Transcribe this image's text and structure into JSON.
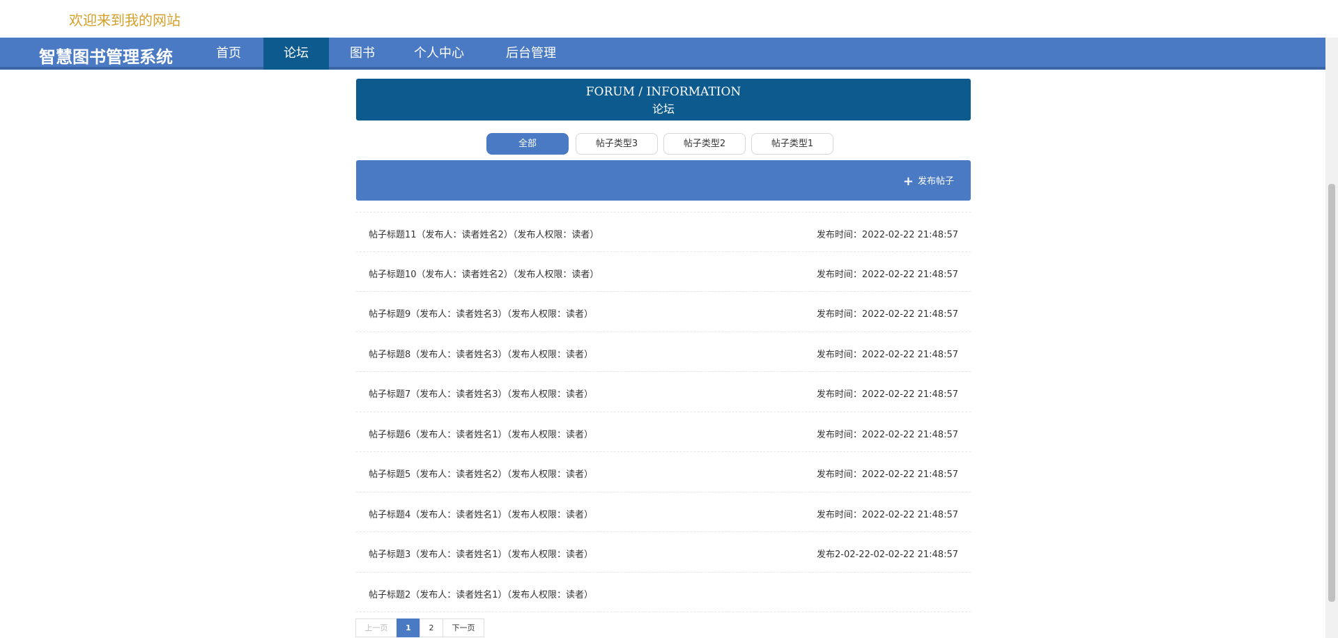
{
  "header": {
    "welcome": "欢迎来到我的网站"
  },
  "nav": {
    "brand": "智慧图书管理系统",
    "items": [
      {
        "label": "首页"
      },
      {
        "label": "论坛"
      },
      {
        "label": "图书"
      },
      {
        "label": "个人中心"
      },
      {
        "label": "后台管理"
      }
    ],
    "active": "论坛"
  },
  "forum": {
    "title_en": "FORUM / INFORMATION",
    "title_cn": "论坛"
  },
  "filters": [
    {
      "label": "全部"
    },
    {
      "label": "帖子类型3"
    },
    {
      "label": "帖子类型2"
    },
    {
      "label": "帖子类型1"
    }
  ],
  "actions": {
    "publish_label": "发布帖子"
  },
  "posts": [
    {
      "title": "帖子标题11（发布人：读者姓名2）（发布人权限：读者）",
      "time": "发布时间：2022-02-22 21:48:57"
    },
    {
      "title": "帖子标题10（发布人：读者姓名2）（发布人权限：读者）",
      "time": "发布时间：2022-02-22 21:48:57"
    },
    {
      "title": "帖子标题9（发布人：读者姓名3）（发布人权限：读者）",
      "time": "发布时间：2022-02-22 21:48:57"
    },
    {
      "title": "帖子标题8（发布人：读者姓名3）（发布人权限：读者）",
      "time": "发布时间：2022-02-22 21:48:57"
    },
    {
      "title": "帖子标题7（发布人：读者姓名3）（发布人权限：读者）",
      "time": "发布时间：2022-02-22 21:48:57"
    },
    {
      "title": "帖子标题6（发布人：读者姓名1）（发布人权限：读者）",
      "time": "发布时间：2022-02-22 21:48:57"
    },
    {
      "title": "帖子标题5（发布人：读者姓名2）（发布人权限：读者）",
      "time": "发布时间：2022-02-22 21:48:57"
    },
    {
      "title": "帖子标题4（发布人：读者姓名1）（发布人权限：读者）",
      "time": "发布时间：2022-02-22 21:48:57"
    },
    {
      "title": "帖子标题3（发布人：读者姓名1）（发布人权限：读者）",
      "time": "发布2-02-22-02-02-22 21:48:57"
    },
    {
      "title": "帖子标题2（发布人：读者姓名1）（发布人权限：读者）",
      "time": ""
    }
  ],
  "pagination": {
    "prev": "上一页",
    "pages": [
      "1",
      "2"
    ],
    "next": "下一页",
    "current": "1"
  },
  "colors": {
    "nav_bg": "#4a7ac3",
    "nav_active": "#0d5a8e",
    "welcome_text": "#d4a02a"
  }
}
